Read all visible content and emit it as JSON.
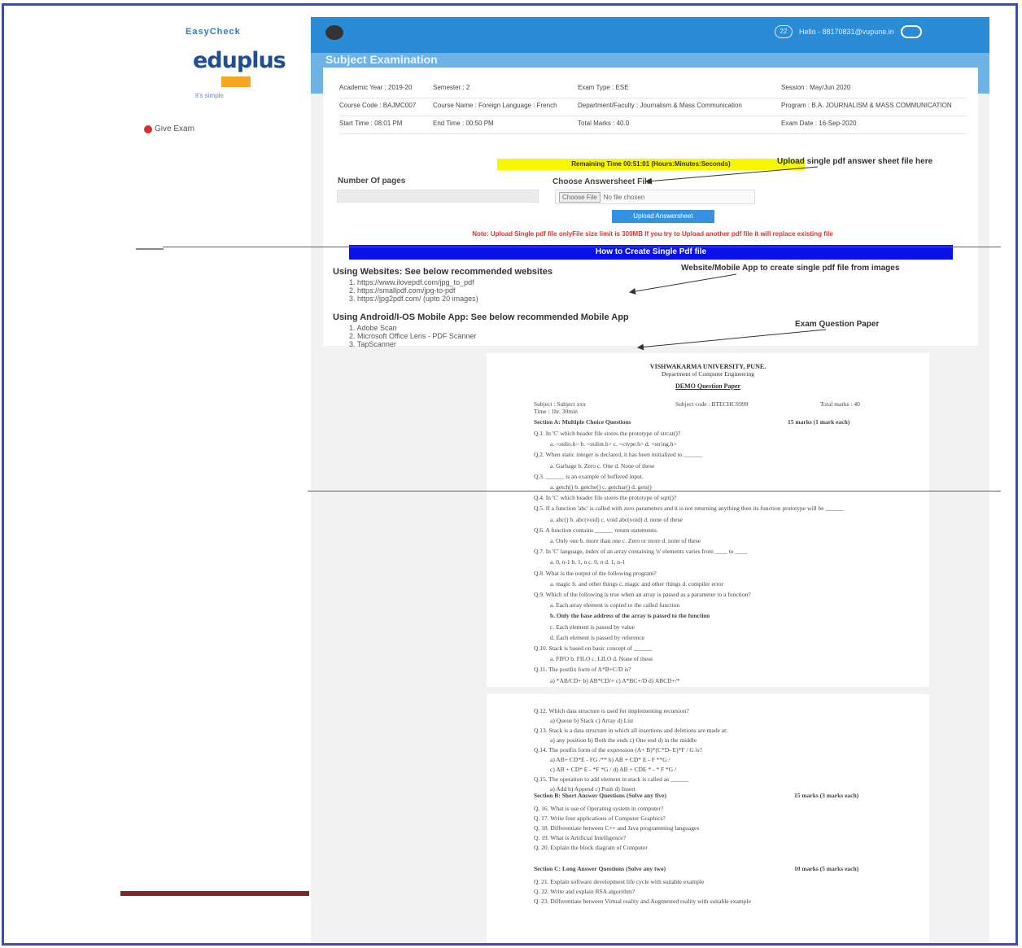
{
  "sidebar": {
    "brand_title": "EasyCheck",
    "logo_text": "eduplus",
    "logo_sub": "it's simple",
    "menu_item": "Give Exam"
  },
  "header": {
    "badge": "22",
    "user_text": "Hello - 88170831@vupune.in"
  },
  "page": {
    "title": "Subject Examination"
  },
  "exam_info": {
    "rows": [
      [
        "Academic Year : 2019-20",
        "Semester : 2",
        "Exam Type : ESE",
        "Session : May/Jun 2020"
      ],
      [
        "Course Code : BAJMC007",
        "Course Name : Foreign Language : French",
        "Department/Faculty : Journalism & Mass Communication",
        "Program : B.A. JOURNALISM & MASS COMMUNICATION"
      ],
      [
        "Start Time : 08:01 PM",
        "End Time : 00:50 PM",
        "Total Marks : 40.0",
        "Exam Date : 16-Sep-2020"
      ]
    ]
  },
  "timer": "Remaining Time 00:51:01 (Hours:Minutes:Seconds)",
  "upload": {
    "pages_label": "Number Of pages",
    "file_label": "Choose Answersheet File",
    "file_button": "Choose File",
    "file_status": "No file chosen",
    "upload_button": "Upload Answersheet",
    "note": "Note: Upload Single pdf file onlyFile size limit is 300MB If you try to Upload another pdf file it will replace existing file",
    "howto_button": "How to Create Single Pdf file"
  },
  "help": {
    "websites_heading": "Using Websites: See below recommended websites",
    "websites": [
      "1. https://www.ilovepdf.com/jpg_to_pdf",
      "2. https://smallpdf.com/jpg-to-pdf",
      "3. https://jpg2pdf.com/ (upto 20 images)"
    ],
    "apps_heading": "Using Android/I-OS Mobile App: See below recommended Mobile App",
    "apps": [
      "1. Adobe Scan",
      "2. Microsoft Office Lens - PDF Scanner",
      "3. TapScanner"
    ]
  },
  "annotations": {
    "upload": "Upload single pdf answer sheet file here",
    "websites": "Website/Mobile App to create single pdf file from images",
    "paper": "Exam Question Paper"
  },
  "paper": {
    "university": "VISHWAKARMA UNIVERSITY, PUNE.",
    "department": "Department of Computer Engineering",
    "title": "DEMO Question Paper",
    "subject": "Subject : Subject xxx",
    "subject_code": "Subject code : BTECHCS999",
    "total_marks": "Total marks : 40",
    "time": "Time : 1hr. 30min",
    "section_a": "Section A: Multiple Choice Questions",
    "section_a_marks": "15 marks (1 mark each)",
    "q_lines_1": [
      "Q.1. In 'C' which header file stores the prototype of strcat()?",
      "a. <stdio.h>     b. <stdint.h>     c. <ctype.h>     d. <string.h>",
      "Q.2. When static integer is declared, it has been initialized to ______",
      "a. Garbage        b. Zero        c. One        d. None of these",
      "Q.3. ______ is an example of buffered input.",
      "a. getch()     b. getche()     c. getchar()     d. gets()",
      "Q.4. In 'C' which header file stores the prototype of sqrt()?",
      "Q.5. If a function 'abc' is called with zero parameters and it is not returning anything then its function prototype will be ______",
      "a. abc()        b. abc(void)        c. void abc(void)        d. none of these",
      "Q.6. A function contains ______ return statements.",
      "a. Only one        b. more than one        c. Zero or more        d. none of these",
      "Q.7. In 'C' language, index of an array containing 'n' elements varies from ____ to ____",
      "a. 0, n-1    b. 1, n    c. 0, n    d. 1, n-1",
      "Q.8. What is the output of the following program?",
      "a. magic        b. and other things        c. magic and other things        d. compiler error",
      "Q.9. Which of the following is true when an array is passed as a parameter to a function?",
      "a. Each array element is copied to the called function",
      "b. Only the base address of the array is passed to the function",
      "c. Each element is passed by value",
      "d. Each element is passed by reference",
      "Q.10. Stack is based on basic concept of ______",
      "a. FIFO    b. FILO    c. LILO    d. None of these",
      "Q.11. The postfix form of A*B+C/D is?",
      "a) *AB/CD+    b) AB*CD/+    c) A*BC+/D    d) ABCD+/*"
    ],
    "q_lines_2": [
      "Q.12. Which data structure is used for implementing recursion?",
      "a) Queue        b) Stack        c) Array        d) List",
      "Q.13. Stack is a data structure in which all insertions and deletions are made at:",
      "a) any position    b) Both the ends    c) One end    d) in the middle",
      "Q.14. The postfix form of the expression (A+ B)*(C*D- E)*F / G is?",
      "a) AB+ CD*E - FG /**    b) AB + CD* E - F **G /",
      "c) AB + CD* E - *F *G /    d) AB + CDE * - * F *G /",
      "Q.15. The operation to add element in stack is called as ______",
      "a) Add    b) Append    c) Push    d) Insert",
      "Q. 16. What is use of Operating system in computer?",
      "Q. 17. Write four applications of Computer Graphics?",
      "Q. 18. Differentiate between C++ and Java programming languages",
      "Q. 19. What is Artificial Intelligence?",
      "Q. 20. Explain the block diagram of Computer",
      "Q. 21. Explain software development life cycle with suitable example",
      "Q. 22. Write and explain RSA algorithm?",
      "Q. 23. Differentiate between Virtual reality and Augmented reality with suitable example"
    ],
    "section_b": "Section B: Short Answer Questions (Solve any five)",
    "section_b_marks": "15 marks (3 marks each)",
    "section_c": "Section C: Long Answer Questions (Solve any two)",
    "section_c_marks": "10 marks (5 marks each)"
  },
  "colors": {
    "frame": "#3d4fa1",
    "topbar": "#2a8bd6",
    "timer_bg": "#f7f700",
    "note_text": "#e03030",
    "howto_bg": "#0a12e8"
  }
}
